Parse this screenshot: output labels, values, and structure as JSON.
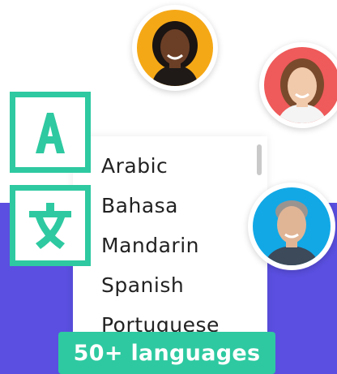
{
  "languages": [
    "Arabic",
    "Bahasa",
    "Mandarin",
    "Spanish",
    "Portuguese"
  ],
  "badge": {
    "label": "50+ languages"
  },
  "icons": {
    "latin": {
      "name": "translate-latin-icon",
      "glyph": "A"
    },
    "chinese": {
      "name": "translate-chinese-icon",
      "glyph": "文"
    }
  },
  "colors": {
    "accent": "#2ec9a0",
    "purple": "#5a4fe0",
    "avatar1_bg": "#f5a816",
    "avatar2_bg": "#ef5a5a",
    "avatar3_bg": "#12a8e6"
  }
}
